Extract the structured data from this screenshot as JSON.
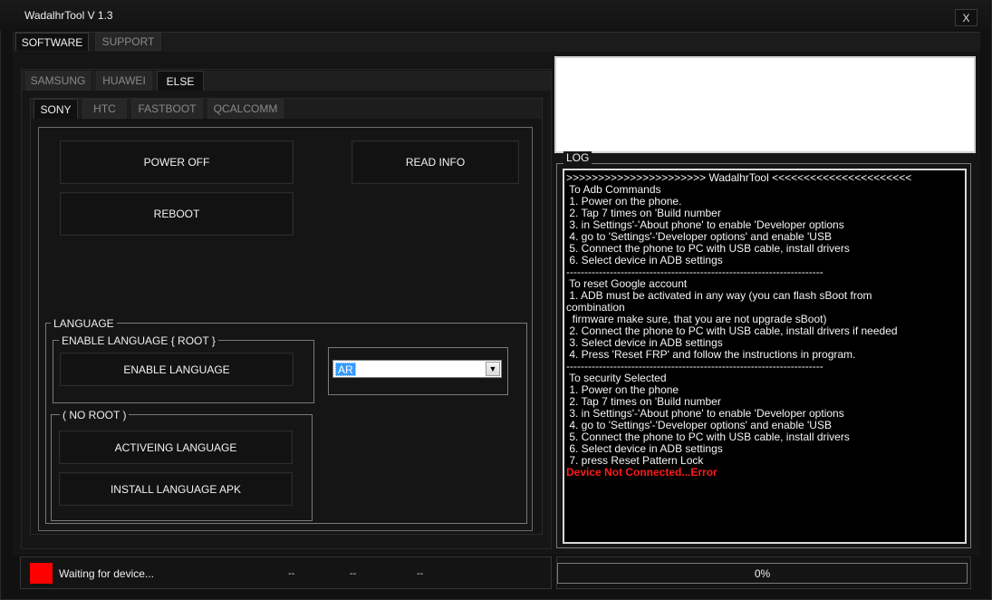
{
  "window": {
    "title": "WadalhrTool V 1.3",
    "close_label": "X"
  },
  "top_tabs": [
    {
      "label": "SOFTWARE"
    },
    {
      "label": "SUPPORT"
    }
  ],
  "brand_tabs": [
    {
      "label": "SAMSUNG"
    },
    {
      "label": "HUAWEI"
    },
    {
      "label": "ELSE"
    }
  ],
  "sub_tabs": [
    {
      "label": "SONY"
    },
    {
      "label": "HTC"
    },
    {
      "label": "FASTBOOT"
    },
    {
      "label": "QCALCOMM"
    }
  ],
  "buttons": {
    "power_off": "POWER OFF",
    "read_info": "READ INFO",
    "reboot": "REBOOT",
    "enable_language": "ENABLE LANGUAGE",
    "activeing_language": "ACTIVEING LANGUAGE",
    "install_language_apk": "INSTALL LANGUAGE APK"
  },
  "language": {
    "group_label": "LANGUAGE",
    "root_label": "ENABLE LANGUAGE { ROOT }",
    "noroot_label": "( NO ROOT )",
    "selected": "AR"
  },
  "log": {
    "label": "LOG",
    "lines": [
      ">>>>>>>>>>>>>>>>>>>>>> WadalhrTool <<<<<<<<<<<<<<<<<<<<<<",
      " To Adb Commands",
      " 1. Power on the phone.",
      " 2. Tap 7 times on 'Build number",
      " 3. in Settings'-'About phone' to enable 'Developer options",
      " 4. go to 'Settings'-'Developer options' and enable 'USB",
      " 5. Connect the phone to PC with USB cable, install drivers",
      " 6. Select device in ADB settings",
      "-----------------------------------------------------------------------",
      " To reset Google account",
      " 1. ADB must be activated in any way (you can flash sBoot from",
      "combination",
      "  firmware make sure, that you are not upgrade sBoot)",
      " 2. Connect the phone to PC with USB cable, install drivers if needed",
      " 3. Select device in ADB settings",
      " 4. Press 'Reset FRP' and follow the instructions in program.",
      "-----------------------------------------------------------------------",
      " To security Selected",
      " 1. Power on the phone",
      " 2. Tap 7 times on 'Build number",
      " 3. in Settings'-'About phone' to enable 'Developer options",
      " 4. go to 'Settings'-'Developer options' and enable 'USB",
      " 5. Connect the phone to PC with USB cable, install drivers",
      " 6. Select device in ADB settings",
      " 7. press Reset Pattern Lock"
    ],
    "error_line": "Device Not Connected...Error"
  },
  "status": {
    "indicator_color": "#ff0000",
    "text": "Waiting for device...",
    "fields": [
      "--",
      "--",
      "--"
    ],
    "progress": 0,
    "progress_label": "0%"
  }
}
